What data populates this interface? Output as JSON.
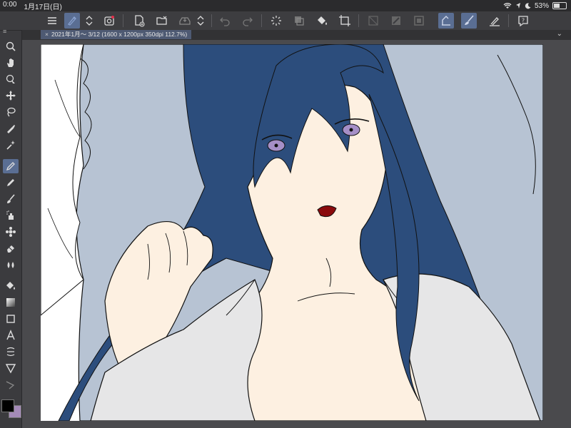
{
  "status_bar": {
    "time": "0:00",
    "date": "1月17日(日)",
    "battery": "53%",
    "battery_level": 0.53
  },
  "document": {
    "tab_title": "2021年1月〜 3/12 (1600 x 1200px 350dpi 112.7%)"
  },
  "toolbar_icons": [
    "menu-icon",
    "selection-tool-icon",
    "stepper-icon",
    "layer-icon",
    "new-file-icon",
    "open-folder-icon",
    "save-icon",
    "stepper-icon",
    "undo-icon",
    "redo-icon",
    "loading-icon",
    "copy-layer-icon",
    "fill-icon",
    "transform-icon",
    "deselect-icon",
    "invert-selection-icon",
    "selection-border-icon",
    "pen-icon",
    "brush-icon",
    "ruler-pen-icon",
    "help-icon"
  ],
  "tools": [
    "zoom-icon",
    "hand-icon",
    "rotate-icon",
    "move-icon",
    "lasso-icon",
    "eyedropper-icon",
    "auto-select-icon",
    "pen-tool-icon",
    "pencil-icon",
    "brush-tool-icon",
    "airbrush-icon",
    "decoration-icon",
    "eraser-icon",
    "blend-icon",
    "fill-tool-icon",
    "gradient-icon",
    "figure-icon",
    "text-icon",
    "frame-icon",
    "ruler-icon",
    "correct-line-icon"
  ],
  "colors": {
    "main": "#000000",
    "sub": "#a48ab8",
    "hair": "#2c4d7c",
    "pillow": "#b7c3d3",
    "skin": "#fdf0e1",
    "shirt": "#e6e6e7",
    "eye": "#a58fc7",
    "mouth": "#8a0a0c",
    "selection": "#5a6e93"
  }
}
